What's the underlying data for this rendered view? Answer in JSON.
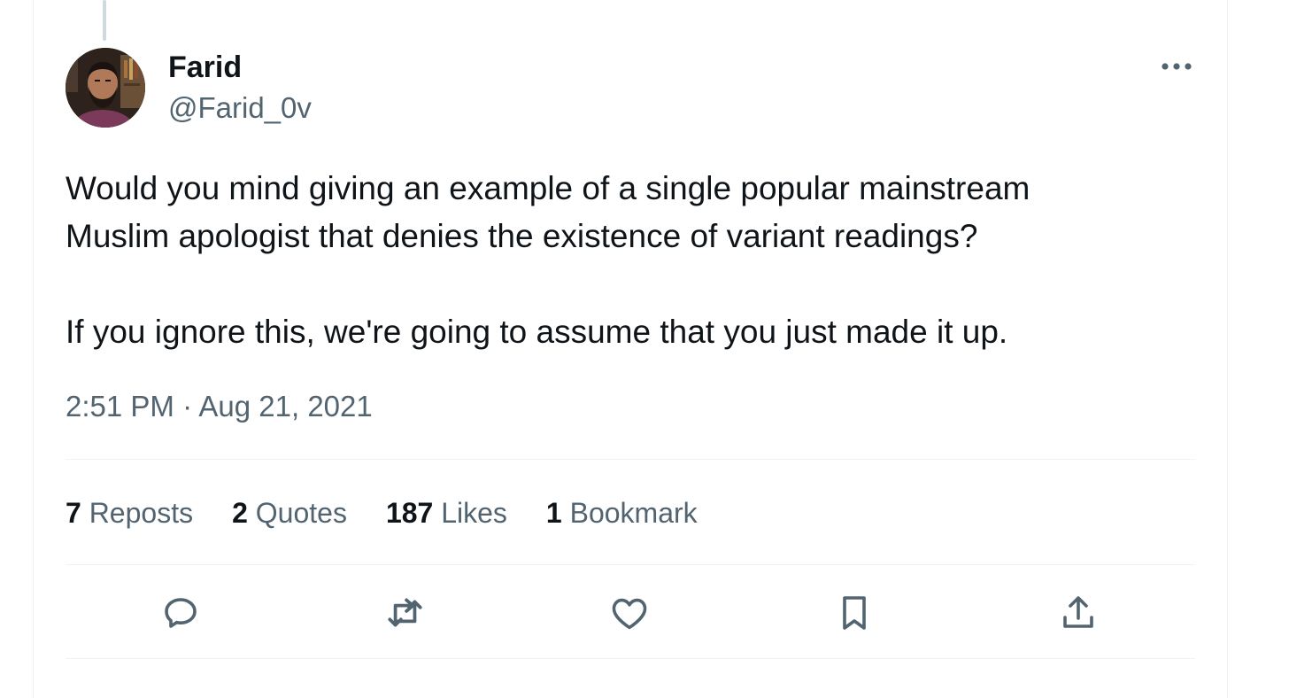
{
  "author": {
    "name": "Farid",
    "handle": "@Farid_0v"
  },
  "tweet": {
    "text_lines": [
      "Would you mind giving an example of a single popular mainstream",
      "Muslim apologist that denies the existence of variant readings?",
      "If you ignore this, we're going to assume that you just made it up."
    ],
    "timestamp": "2:51 PM · Aug 21, 2021"
  },
  "stats": {
    "reposts": {
      "count": "7",
      "label": "Reposts"
    },
    "quotes": {
      "count": "2",
      "label": "Quotes"
    },
    "likes": {
      "count": "187",
      "label": "Likes"
    },
    "bookmarks": {
      "count": "1",
      "label": "Bookmark"
    }
  },
  "icons": {
    "more": "more-icon",
    "reply": "reply-icon",
    "repost": "repost-icon",
    "like": "heart-icon",
    "bookmark": "bookmark-icon",
    "share": "share-icon"
  },
  "colors": {
    "text_primary": "#0f1419",
    "text_secondary": "#536471",
    "divider": "#eff3f4"
  }
}
